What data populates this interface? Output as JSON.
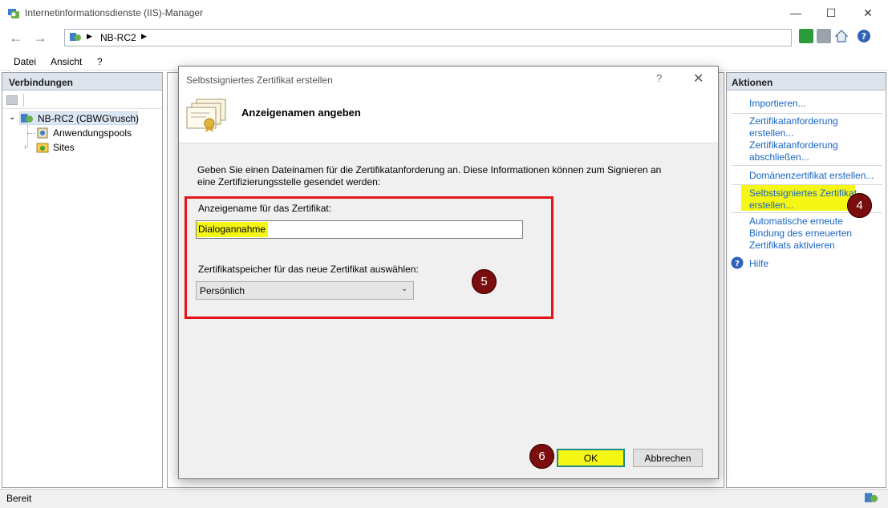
{
  "window": {
    "title": "Internetinformationsdienste (IIS)-Manager",
    "minimize_glyph": "—",
    "maximize_glyph": "☐",
    "close_glyph": "✕"
  },
  "address": {
    "path": "NB-RC2",
    "back_glyph": "←",
    "forward_glyph": "→"
  },
  "menu": {
    "items": [
      "Datei",
      "Ansicht",
      "?"
    ]
  },
  "connections": {
    "title": "Verbindungen",
    "tree": {
      "root": "NB-RC2 (CBWG\\rusch)",
      "children": [
        "Anwendungspools",
        "Sites"
      ]
    }
  },
  "actions": {
    "title": "Aktionen",
    "items": [
      "Importieren...",
      "Zertifikatanforderung erstellen...",
      "Zertifikatanforderung abschließen...",
      "Domänenzertifikat erstellen...",
      "Selbstsigniertes Zertifikat erstellen...",
      "Automatische erneute Bindung des erneuerten Zertifikats aktivieren",
      "Hilfe"
    ]
  },
  "status": {
    "text": "Bereit"
  },
  "dialog": {
    "title": "Selbstsigniertes Zertifikat erstellen",
    "help_glyph": "?",
    "close_glyph": "✕",
    "heading": "Anzeigenamen angeben",
    "description": "Geben Sie einen Dateinamen für die Zertifikatanforderung an. Diese Informationen können zum Signieren an eine Zertifizierungsstelle gesendet werden:",
    "name_label": "Anzeigename für das Zertifikat:",
    "name_value": "Dialogannahme",
    "store_label": "Zertifikatspeicher für das neue Zertifikat auswählen:",
    "store_value": "Persönlich",
    "ok_label": "OK",
    "cancel_label": "Abbrechen"
  },
  "badges": [
    "4",
    "5",
    "6"
  ],
  "colors": {
    "highlight": "#f6f614",
    "annotation_red": "#e4141b",
    "badge": "#7a0d0d",
    "link": "#1a65c2"
  },
  "icons": [
    "iis-app-icon",
    "server-icon",
    "app-pool-icon",
    "sites-icon",
    "certificate-icon",
    "help-icon",
    "refresh-icon",
    "stop-icon",
    "home-icon"
  ]
}
